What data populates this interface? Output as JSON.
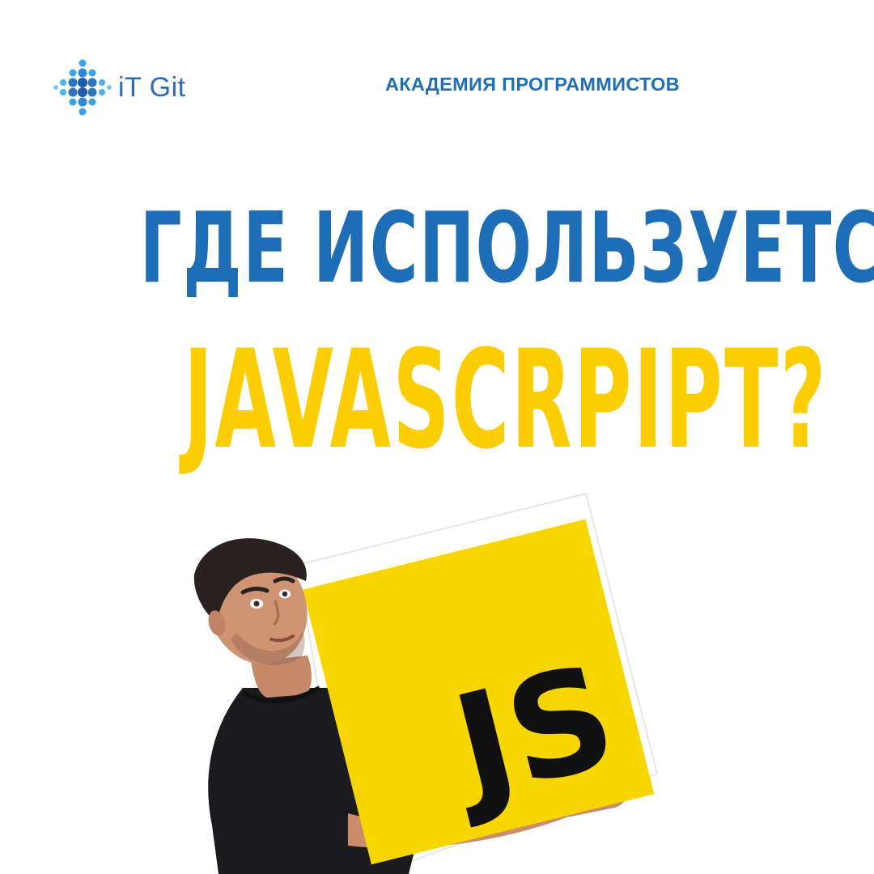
{
  "brand": {
    "logo_text": "iT Git",
    "tagline": "АКАДЕМИЯ ПРОГРАММИСТОВ",
    "color_blue": "#1e6eb7",
    "color_yellow": "#fccd00"
  },
  "headline": {
    "line1": "ГДЕ ИСПОЛЬЗУЕТСЯ",
    "line2": "JAVASCRPIPT?"
  },
  "illustration": {
    "badge_text": "JS",
    "badge_color": "#f7d500",
    "subject": "man holding a JavaScript logo box"
  }
}
